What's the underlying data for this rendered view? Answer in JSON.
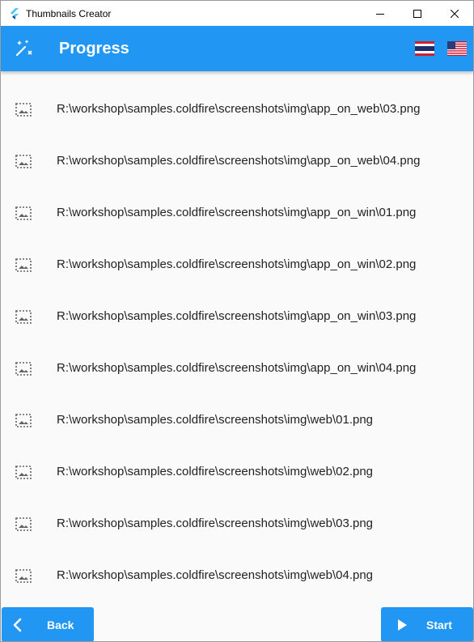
{
  "window": {
    "title": "Thumbnails Creator"
  },
  "appbar": {
    "title": "Progress",
    "languages": [
      "th",
      "en-us"
    ]
  },
  "files": [
    "R:\\workshop\\samples.coldfire\\screenshots\\img\\app_on_web\\03.png",
    "R:\\workshop\\samples.coldfire\\screenshots\\img\\app_on_web\\04.png",
    "R:\\workshop\\samples.coldfire\\screenshots\\img\\app_on_win\\01.png",
    "R:\\workshop\\samples.coldfire\\screenshots\\img\\app_on_win\\02.png",
    "R:\\workshop\\samples.coldfire\\screenshots\\img\\app_on_win\\03.png",
    "R:\\workshop\\samples.coldfire\\screenshots\\img\\app_on_win\\04.png",
    "R:\\workshop\\samples.coldfire\\screenshots\\img\\web\\01.png",
    "R:\\workshop\\samples.coldfire\\screenshots\\img\\web\\02.png",
    "R:\\workshop\\samples.coldfire\\screenshots\\img\\web\\03.png",
    "R:\\workshop\\samples.coldfire\\screenshots\\img\\web\\04.png"
  ],
  "buttons": {
    "back_label": "Back",
    "start_label": "Start"
  },
  "colors": {
    "primary": "#2196f3",
    "background": "#fafafa",
    "icon": "#616161"
  }
}
